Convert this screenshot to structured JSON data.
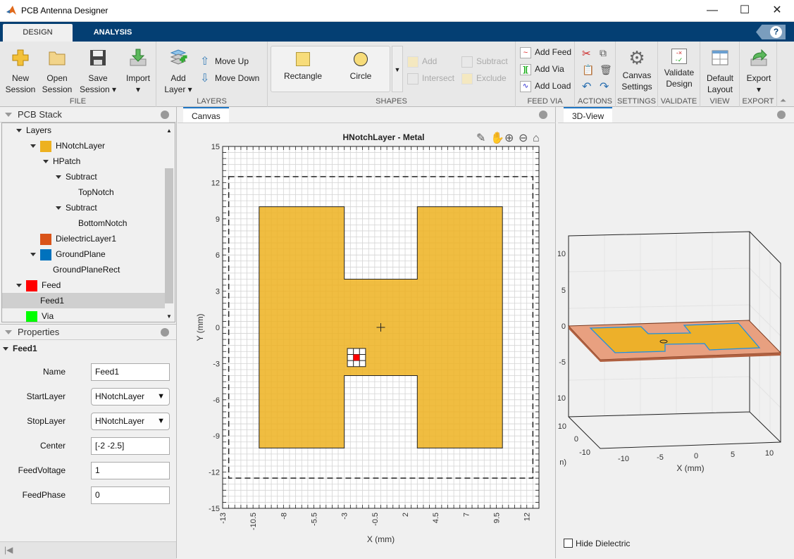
{
  "window": {
    "title": "PCB Antenna Designer",
    "minimize": "—",
    "maximize": "☐",
    "close": "✕"
  },
  "ribbon": {
    "tabs": [
      {
        "label": "DESIGN",
        "active": true
      },
      {
        "label": "ANALYSIS",
        "active": false
      }
    ],
    "help": "?",
    "groups": {
      "file": "FILE",
      "layers": "LAYERS",
      "shapes": "SHAPES",
      "feed_via": "FEED VIA",
      "actions": "ACTIONS",
      "settings": "SETTINGS",
      "validate": "VALIDATE",
      "view": "VIEW",
      "export": "EXPORT"
    },
    "new_session": [
      "New",
      "Session"
    ],
    "open_session": [
      "Open",
      "Session"
    ],
    "save_session": [
      "Save",
      "Session ▾"
    ],
    "import": [
      "Import",
      "▾"
    ],
    "add_layer": [
      "Add",
      "Layer ▾"
    ],
    "move_up": "Move Up",
    "move_down": "Move Down",
    "rectangle": "Rectangle",
    "circle": "Circle",
    "add": "Add",
    "intersect": "Intersect",
    "subtract": "Subtract",
    "exclude": "Exclude",
    "add_feed": "Add Feed",
    "add_via": "Add Via",
    "add_load": "Add Load",
    "canvas_settings": [
      "Canvas",
      "Settings"
    ],
    "validate_design": [
      "Validate",
      "Design"
    ],
    "default_layout": [
      "Default",
      "Layout"
    ],
    "export": [
      "Export",
      "▾"
    ]
  },
  "pcb_stack": {
    "title": "PCB Stack",
    "items": [
      {
        "label": "Layers",
        "level": 0,
        "expand": true
      },
      {
        "label": "HNotchLayer",
        "level": 1,
        "expand": true,
        "color": "#edb120"
      },
      {
        "label": "HPatch",
        "level": 2,
        "expand": true
      },
      {
        "label": "Subtract",
        "level": 3,
        "expand": true
      },
      {
        "label": "TopNotch",
        "level": 4
      },
      {
        "label": "Subtract",
        "level": 3,
        "expand": true
      },
      {
        "label": "BottomNotch",
        "level": 4
      },
      {
        "label": "DielectricLayer1",
        "level": 1,
        "color": "#d95319"
      },
      {
        "label": "GroundPlane",
        "level": 1,
        "expand": true,
        "color": "#0072bd"
      },
      {
        "label": "GroundPlaneRect",
        "level": 2
      },
      {
        "label": "Feed",
        "level": 0,
        "expand": true,
        "color": "#ff0000"
      },
      {
        "label": "Feed1",
        "level": 1,
        "selected": true
      },
      {
        "label": "Via",
        "level": 0,
        "color": "#00ff00"
      }
    ]
  },
  "properties": {
    "title": "Properties",
    "section": "Feed1",
    "fields": [
      {
        "label": "Name",
        "value": "Feed1",
        "type": "text"
      },
      {
        "label": "StartLayer",
        "value": "HNotchLayer",
        "type": "dropdown"
      },
      {
        "label": "StopLayer",
        "value": "HNotchLayer",
        "type": "dropdown"
      },
      {
        "label": "Center",
        "value": "[-2 -2.5]",
        "type": "text"
      },
      {
        "label": "FeedVoltage",
        "value": "1",
        "type": "text"
      },
      {
        "label": "FeedPhase",
        "value": "0",
        "type": "text"
      }
    ]
  },
  "canvas": {
    "tab": "Canvas",
    "title": "HNotchLayer - Metal",
    "xlabel": "X (mm)",
    "ylabel": "Y (mm)",
    "xlim": [
      -13,
      13
    ],
    "ylim": [
      -15,
      15
    ],
    "xticks": [
      "-13",
      "-10.5",
      "-8",
      "-5.5",
      "-3",
      "-0.5",
      "2",
      "4.5",
      "7",
      "9.5",
      "12"
    ],
    "yticks": [
      "15",
      "12",
      "9",
      "6",
      "3",
      "0",
      "-3",
      "-6",
      "-9",
      "-12",
      "-15"
    ],
    "metal_color": "#edb120",
    "hpatch": [
      [
        -10,
        10
      ],
      [
        -3,
        10
      ],
      [
        -3,
        4
      ],
      [
        3,
        4
      ],
      [
        3,
        10
      ],
      [
        10,
        10
      ],
      [
        10,
        -10
      ],
      [
        3,
        -10
      ],
      [
        3,
        -4
      ],
      [
        -3,
        -4
      ],
      [
        -3,
        -10
      ],
      [
        -10,
        -10
      ]
    ],
    "board_outline": [
      -12.5,
      12.5,
      -12.5,
      12.5
    ],
    "feed_center": [
      -2,
      -2.5
    ],
    "feed_color": "#ff0000"
  },
  "view3d": {
    "tab": "3D-View",
    "xlabel": "X (mm)",
    "ylabel_partial": "n)",
    "xticks": [
      "-10",
      "-5",
      "0",
      "5",
      "10"
    ],
    "yticks": [
      "10",
      "0",
      "-10"
    ],
    "zticks": [
      "10",
      "5",
      "0",
      "-5",
      "-10"
    ],
    "hide_dielectric": {
      "label": "Hide Dielectric",
      "checked": false
    }
  }
}
